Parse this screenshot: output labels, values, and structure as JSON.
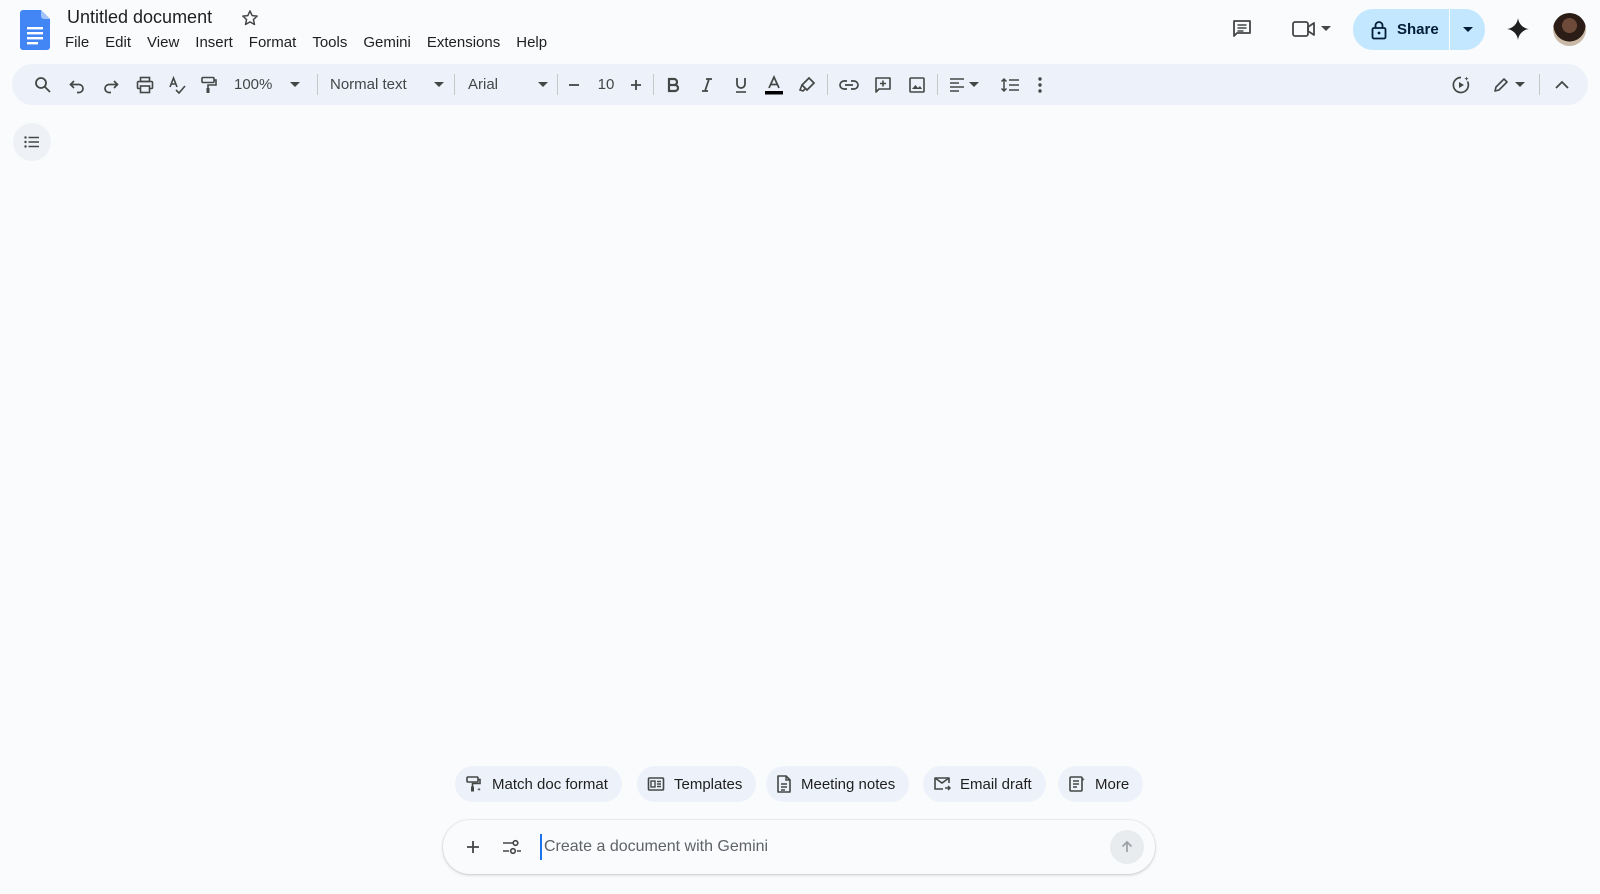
{
  "app": {
    "accent": "#1a73e8",
    "share_bg": "#c2e7ff"
  },
  "document": {
    "title": "Untitled document"
  },
  "menubar": {
    "items": [
      {
        "label": "File"
      },
      {
        "label": "Edit"
      },
      {
        "label": "View"
      },
      {
        "label": "Insert"
      },
      {
        "label": "Format"
      },
      {
        "label": "Tools"
      },
      {
        "label": "Gemini"
      },
      {
        "label": "Extensions"
      },
      {
        "label": "Help"
      }
    ]
  },
  "header": {
    "share_label": "Share"
  },
  "toolbar": {
    "zoom": "100%",
    "style": "Normal text",
    "font": "Arial",
    "font_size": "10"
  },
  "suggestions": [
    {
      "label": "Match doc format",
      "icon": "match-format-icon"
    },
    {
      "label": "Templates",
      "icon": "templates-icon"
    },
    {
      "label": "Meeting notes",
      "icon": "document-icon"
    },
    {
      "label": "Email draft",
      "icon": "email-draft-icon"
    },
    {
      "label": "More",
      "icon": "more-docs-icon"
    }
  ],
  "prompt": {
    "placeholder": "Create a document with Gemini",
    "value": ""
  }
}
